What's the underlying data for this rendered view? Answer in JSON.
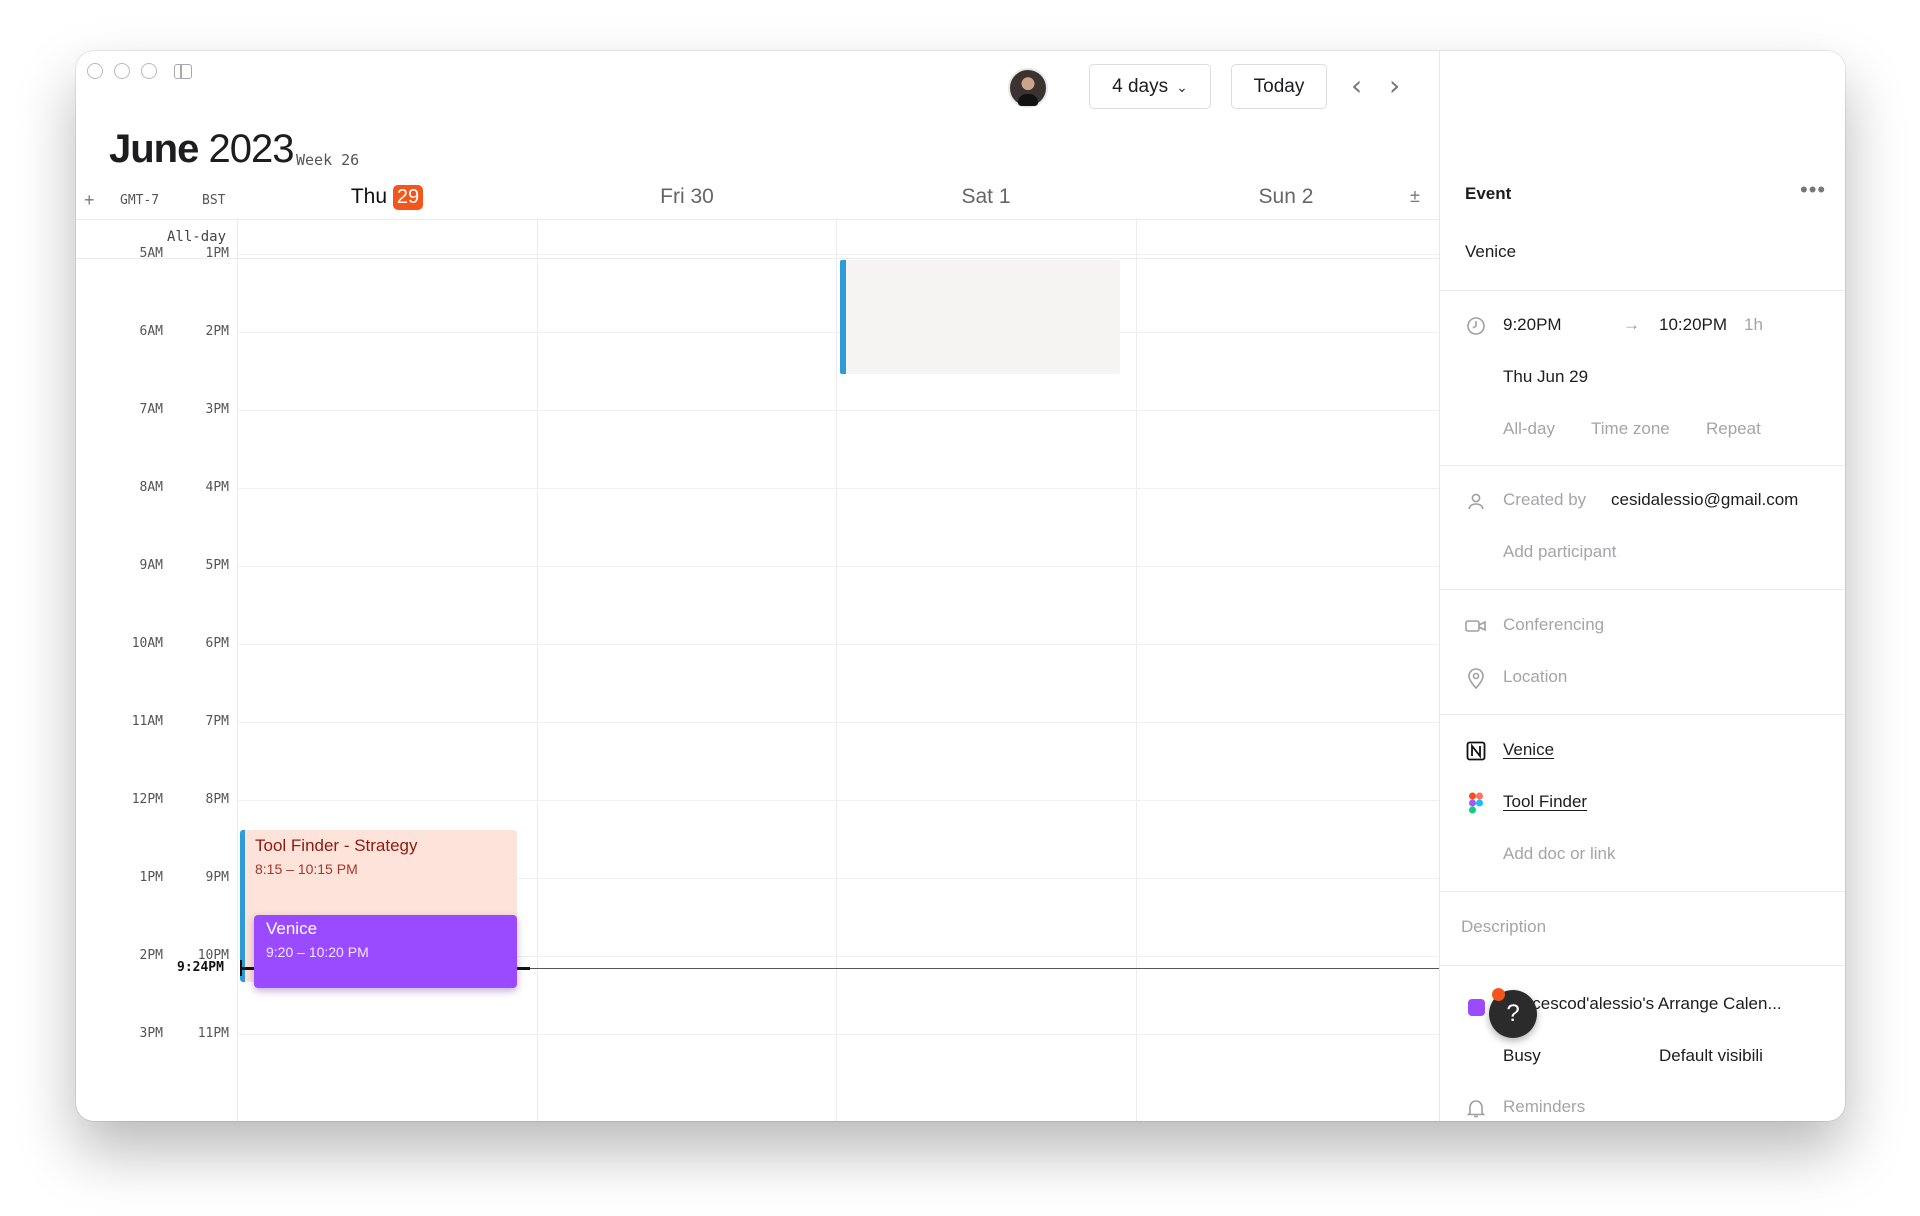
{
  "header": {
    "month": "June",
    "year": "2023",
    "week": "Week 26",
    "view_select": "4 days",
    "today_button": "Today",
    "prev": "‹",
    "next": "›"
  },
  "columns": {
    "add_timezone": "+",
    "tz_primary": "GMT-7",
    "tz_secondary": "BST",
    "allday": "All-day",
    "expand": "±",
    "days": [
      {
        "weekday": "Thu",
        "date": "29",
        "is_today": true
      },
      {
        "weekday": "Fri",
        "date": "30"
      },
      {
        "weekday": "Sat",
        "date": "1"
      },
      {
        "weekday": "Sun",
        "date": "2"
      }
    ]
  },
  "hours": [
    {
      "primary": "5AM",
      "secondary": "1PM"
    },
    {
      "primary": "6AM",
      "secondary": "2PM"
    },
    {
      "primary": "7AM",
      "secondary": "3PM"
    },
    {
      "primary": "8AM",
      "secondary": "4PM"
    },
    {
      "primary": "9AM",
      "secondary": "5PM"
    },
    {
      "primary": "10AM",
      "secondary": "6PM"
    },
    {
      "primary": "11AM",
      "secondary": "7PM"
    },
    {
      "primary": "12PM",
      "secondary": "8PM"
    },
    {
      "primary": "1PM",
      "secondary": "9PM"
    },
    {
      "primary": "2PM",
      "secondary": "10PM"
    },
    {
      "primary": "3PM",
      "secondary": "11PM"
    }
  ],
  "now_label": "9:24PM",
  "events": {
    "toolfinder": {
      "title": "Tool Finder - Strategy",
      "time": "8:15 – 10:15 PM",
      "color": "#fde3da",
      "accent": "#2f9bd6"
    },
    "venice": {
      "title": "Venice",
      "time": "9:20 – 10:20 PM",
      "color": "#9b4bff"
    }
  },
  "panel": {
    "heading": "Event",
    "more": "•••",
    "title": "Venice",
    "start_time": "9:20PM",
    "end_time": "10:20PM",
    "duration": "1h",
    "date": "Thu Jun 29",
    "allday": "All-day",
    "timezone": "Time zone",
    "repeat": "Repeat",
    "created_by_label": "Created by",
    "created_by": "cesidalessio@gmail.com",
    "add_participant": "Add participant",
    "conferencing": "Conferencing",
    "location": "Location",
    "doc_notion": "Venice",
    "doc_figma": "Tool Finder",
    "add_doc": "Add doc or link",
    "description": "Description",
    "calendar": "francescod'alessio's Arrange Calen...",
    "busy": "Busy",
    "visibility": "Default visibili",
    "reminders": "Reminders",
    "help": "?"
  }
}
